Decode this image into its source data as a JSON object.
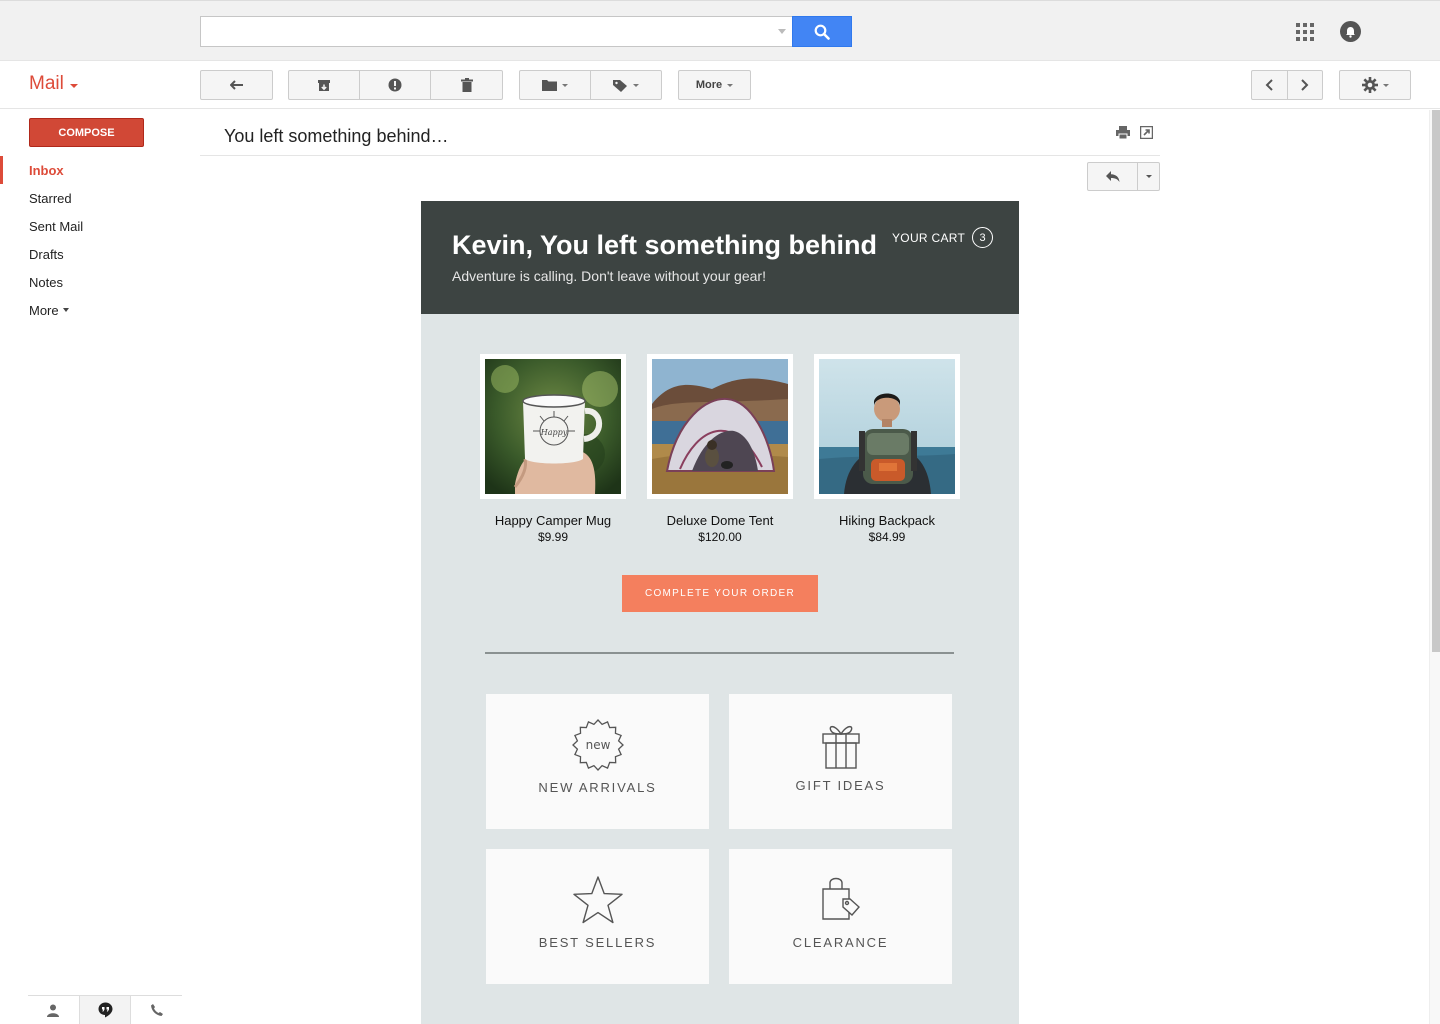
{
  "search": {
    "placeholder": ""
  },
  "app": {
    "name": "Mail"
  },
  "toolbar": {
    "more_label": "More"
  },
  "sidebar": {
    "compose_label": "COMPOSE",
    "items": [
      {
        "label": "Inbox",
        "active": true
      },
      {
        "label": "Starred"
      },
      {
        "label": "Sent Mail"
      },
      {
        "label": "Drafts"
      },
      {
        "label": "Notes"
      },
      {
        "label": "More"
      }
    ]
  },
  "message": {
    "subject": "You left something behind…"
  },
  "email": {
    "hero_title": "Kevin, You left something behind",
    "hero_subtitle": "Adventure is calling. Don't leave without your gear!",
    "cart_label": "YOUR CART",
    "cart_count": "3",
    "products": [
      {
        "name": "Happy Camper Mug",
        "price": "$9.99"
      },
      {
        "name": "Deluxe Dome Tent",
        "price": "$120.00"
      },
      {
        "name": "Hiking Backpack",
        "price": "$84.99"
      }
    ],
    "cta_label": "COMPLETE YOUR ORDER",
    "new_badge_text": "new",
    "categories": [
      {
        "label": "NEW ARRIVALS",
        "icon": "new-badge-icon"
      },
      {
        "label": "GIFT IDEAS",
        "icon": "gift-icon"
      },
      {
        "label": "BEST SELLERS",
        "icon": "star-icon"
      },
      {
        "label": "CLEARANCE",
        "icon": "shopping-bag-tag-icon"
      }
    ]
  },
  "colors": {
    "brand_red": "#dd4b39",
    "search_blue": "#4285f4",
    "hero_bg": "#3d4442",
    "email_bg": "#dfe5e6",
    "cta": "#f47f5e"
  }
}
